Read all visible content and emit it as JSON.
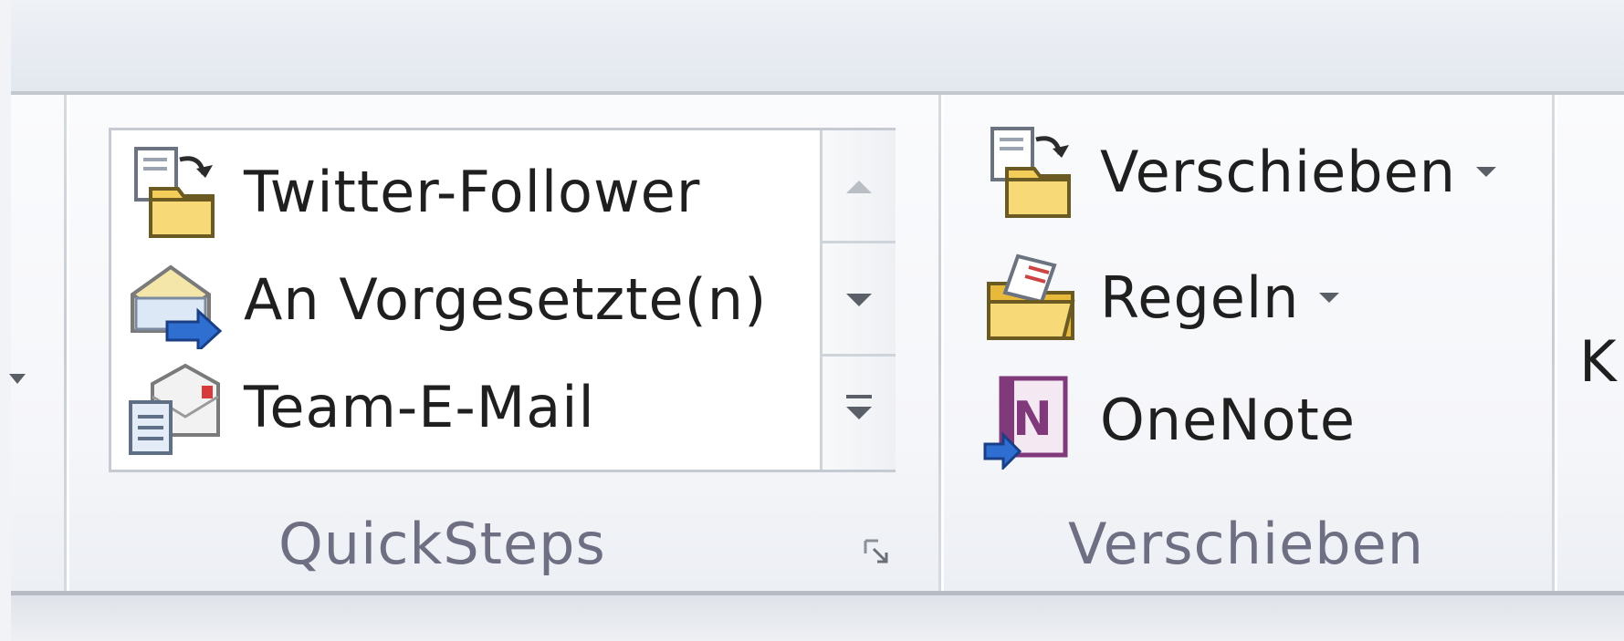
{
  "quicksteps": {
    "items": [
      {
        "label": "Twitter-Follower",
        "icon": "move-to-folder-icon"
      },
      {
        "label": "An Vorgesetzte(n)",
        "icon": "forward-mail-icon"
      },
      {
        "label": "Team-E-Mail",
        "icon": "team-mail-icon"
      }
    ],
    "group_label": "QuickSteps"
  },
  "move": {
    "buttons": [
      {
        "label": "Verschieben",
        "icon": "move-to-folder-icon"
      },
      {
        "label": "Regeln",
        "icon": "rules-icon"
      },
      {
        "label": "OneNote",
        "icon": "onenote-icon"
      }
    ],
    "group_label": "Verschieben"
  },
  "next_group_fragment": "K",
  "colors": {
    "group_label": "#6e6f82",
    "onenote": "#80397b",
    "folder": "#f2c94c",
    "arrow_blue": "#2f6fd1"
  }
}
